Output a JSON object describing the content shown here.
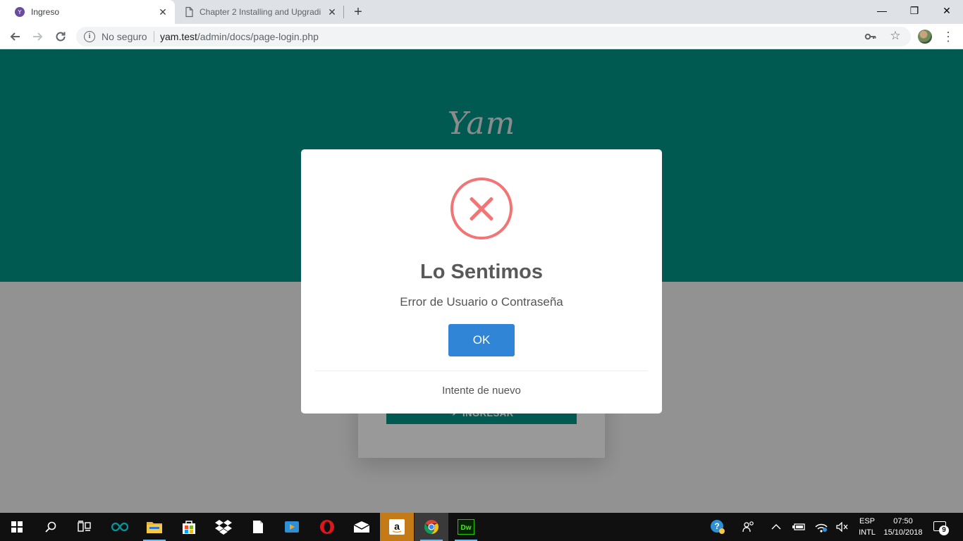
{
  "browser": {
    "tabs": [
      {
        "title": "Ingreso",
        "active": true
      },
      {
        "title": "Chapter 2 Installing and Upgradi",
        "active": false
      }
    ],
    "security_label": "No seguro",
    "url_host": "yam.test",
    "url_path": "/admin/docs/page-login.php"
  },
  "page": {
    "logo_text": "Yam",
    "login_button_label": "INGRESAR",
    "colors": {
      "primary": "#009688",
      "error": "#f27474",
      "confirm": "#3085d6"
    }
  },
  "modal": {
    "icon": "error-x-icon",
    "title": "Lo Sentimos",
    "text": "Error de Usuario o Contraseña",
    "confirm_label": "OK",
    "footer": "Intente de nuevo"
  },
  "taskbar": {
    "apps": [
      "windows-start",
      "search",
      "task-view",
      "arduino",
      "file-explorer",
      "microsoft-store",
      "dropbox",
      "notepad",
      "media-player",
      "opera",
      "mail",
      "amazon",
      "chrome",
      "dreamweaver"
    ],
    "language_top": "ESP",
    "language_bottom": "INTL",
    "time": "07:50",
    "date": "15/10/2018",
    "notifications_count": "9"
  }
}
